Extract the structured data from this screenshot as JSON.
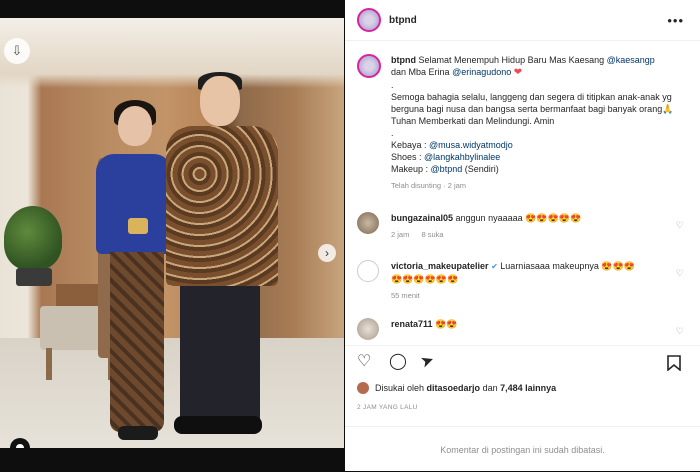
{
  "post": {
    "username": "btpnd",
    "more_icon": "more-horizontal-icon",
    "caption": {
      "username": "btpnd",
      "text1": "Selamat Menempuh Hidup Baru Mas Kaesang",
      "mention1": "@kaesangp",
      "text2": "dan Mba Erina",
      "mention2": "@erinagudono",
      "heart": "❤",
      "dot": ".",
      "body": "Semoga bahagia selalu, langgeng dan segera di titipkan anak-anak yg berguna bagi nusa dan bangsa serta bermanfaat bagi banyak orang🙏 Tuhan Memberkati dan Melindungi. Amin",
      "dot2": ".",
      "kebaya_label": "Kebaya :",
      "kebaya_mention": "@musa.widyatmodjo",
      "shoes_label": "Shoes :",
      "shoes_mention": "@langkahbylinalee",
      "makeup_label": "Makeup :",
      "makeup_mention": "@btpnd",
      "makeup_suffix": "(Sendiri)",
      "edited": "Telah disunting · 2 jam"
    },
    "comments": [
      {
        "username": "bungazainal05",
        "text": "anggun nyaaaaa",
        "emoji": "😍😍😍😍😍",
        "time": "2 jam",
        "likes": "8 suka"
      },
      {
        "username": "victoria_makeupatelier",
        "text": "Luarniasaaa makeupnya",
        "emoji": "😍😍😍",
        "emoji2": "😍😍😍😍😍😍",
        "time": "55 menit"
      },
      {
        "username": "renata711",
        "text": "",
        "emoji": "😍😍"
      }
    ],
    "likes": {
      "prefix": "Disukai oleh",
      "user": "ditasoedarjo",
      "connector": "dan",
      "count": "7,484 lainnya"
    },
    "time_ago": "2 JAM YANG LALU",
    "comments_closed": "Komentar di postingan ini sudah dibatasi."
  },
  "colors": {
    "mention": "#00376b",
    "heart": "#ed4956",
    "verified": "#3897f0",
    "bookmark": "#262626"
  }
}
